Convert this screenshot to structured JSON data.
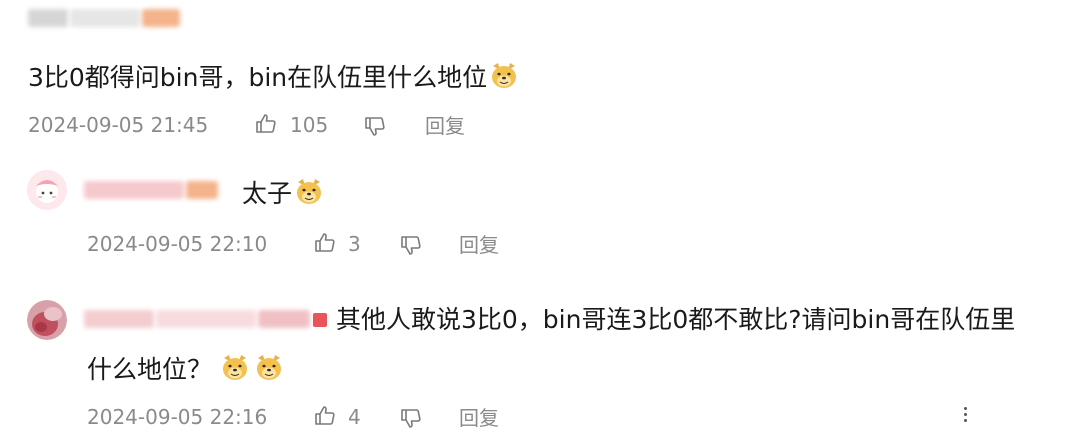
{
  "colors": {
    "text": "#1a1a1a",
    "meta": "#8a8a8a",
    "blur_pink": "#f6c9cc",
    "blur_orange": "#f4b38b",
    "blur_gray": "#d9d9d9",
    "badge_red": "#e8545a"
  },
  "comments": [
    {
      "text": "3比0都得问bin哥，bin在队伍里什么地位",
      "emoji": [
        "doge-icon"
      ],
      "time": "2024-09-05 21:45",
      "likes": "105",
      "reply_label": "回复"
    },
    {
      "text": "太子",
      "emoji": [
        "doge-icon"
      ],
      "time": "2024-09-05 22:10",
      "likes": "3",
      "reply_label": "回复"
    },
    {
      "text_line1": "其他人敢说3比0，bin哥连3比0都不敢比?请问bin哥在队伍里",
      "text_line2": "什么地位？",
      "emoji": [
        "doge-icon",
        "doge-icon"
      ],
      "time": "2024-09-05 22:16",
      "likes": "4",
      "reply_label": "回复"
    }
  ]
}
